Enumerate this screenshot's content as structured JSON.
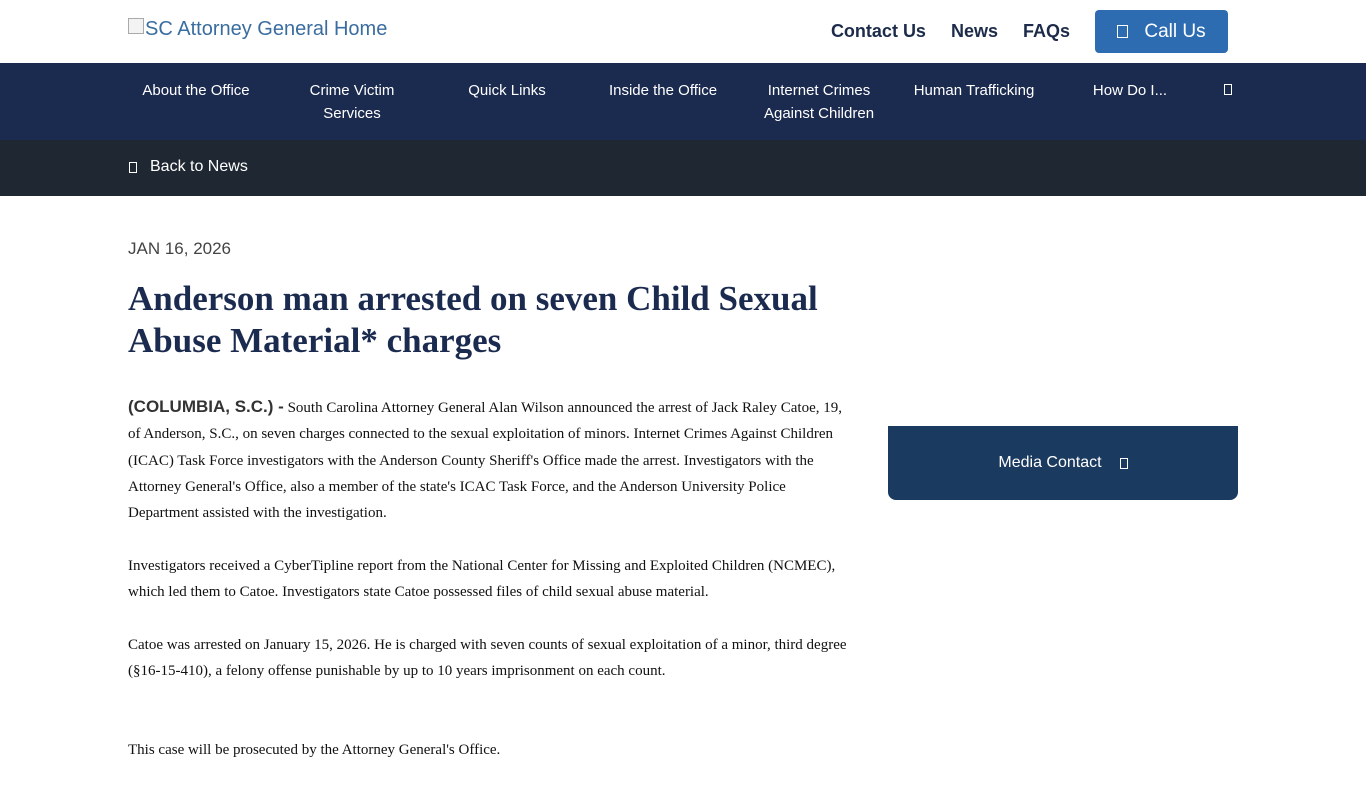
{
  "header": {
    "logo_alt": "SC Attorney General Home",
    "links": [
      "Contact Us",
      "News",
      "FAQs"
    ],
    "call_label": "Call Us"
  },
  "nav": {
    "items": [
      "About the Office",
      "Crime Victim Services",
      "Quick Links",
      "Inside the Office",
      "Internet Crimes Against Children",
      "Human Trafficking",
      "How Do I..."
    ]
  },
  "subbar": {
    "back_label": "Back to News"
  },
  "article": {
    "date": "JAN 16, 2026",
    "title": "Anderson man arrested on seven Child Sexual Abuse Material* charges",
    "dateline": "(COLUMBIA, S.C.) -",
    "p1": "South Carolina Attorney General Alan Wilson announced the arrest of Jack Raley Catoe, 19, of Anderson, S.C., on seven charges connected to the sexual exploitation of minors. Internet Crimes Against Children (ICAC) Task Force investigators with the Anderson County Sheriff's Office made the arrest. Investigators with the Attorney General's Office, also a member of the state's ICAC Task Force, and the Anderson University Police Department assisted with the investigation.",
    "p2": "Investigators received a CyberTipline report from the National Center for Missing and Exploited Children (NCMEC), which led them to Catoe. Investigators state Catoe possessed files of child sexual abuse material.",
    "p3": "Catoe was arrested on January 15, 2026. He is charged with seven counts of sexual exploitation of a minor, third degree (§16-15-410), a felony offense punishable by up to 10 years imprisonment on each count.",
    "p4": "This case will be prosecuted by the Attorney General's Office."
  },
  "sidebar": {
    "media_contact_label": "Media Contact"
  }
}
